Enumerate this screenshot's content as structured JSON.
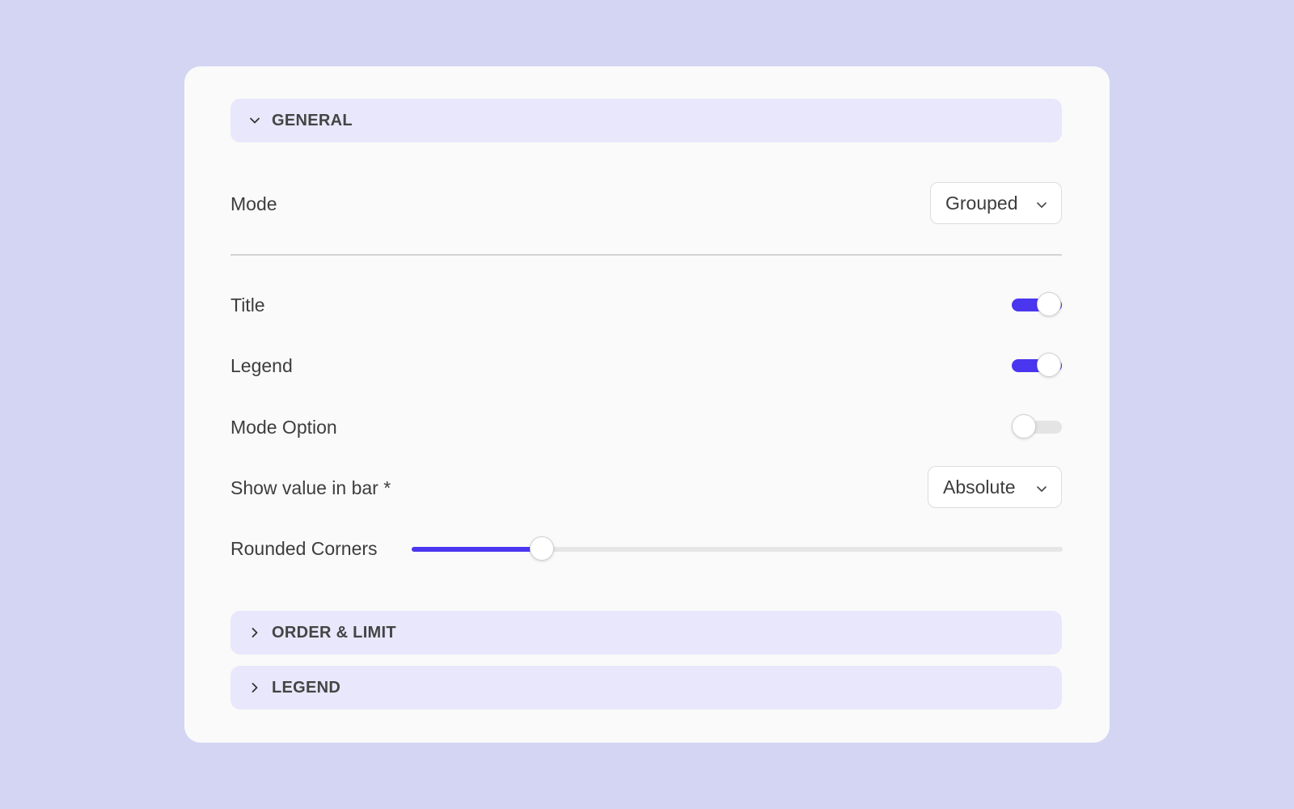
{
  "colors": {
    "background": "#d3d5f3",
    "panel": "#fafafa",
    "section_header": "#e8e7fb",
    "accent": "#4a36ee"
  },
  "sections": [
    {
      "label": "GENERAL",
      "expanded": true,
      "icon": "chevron-down-icon"
    },
    {
      "label": "ORDER & LIMIT",
      "expanded": false,
      "icon": "chevron-right-icon"
    },
    {
      "label": "LEGEND",
      "expanded": false,
      "icon": "chevron-right-icon"
    }
  ],
  "general": {
    "mode": {
      "label": "Mode",
      "value": "Grouped"
    },
    "title_toggle": {
      "label": "Title",
      "on": true
    },
    "legend_toggle": {
      "label": "Legend",
      "on": true
    },
    "mode_option_toggle": {
      "label": "Mode Option",
      "on": false
    },
    "show_value": {
      "label": "Show value in bar *",
      "value": "Absolute"
    },
    "rounded_corners": {
      "label": "Rounded Corners",
      "value_fraction": 0.2
    }
  }
}
